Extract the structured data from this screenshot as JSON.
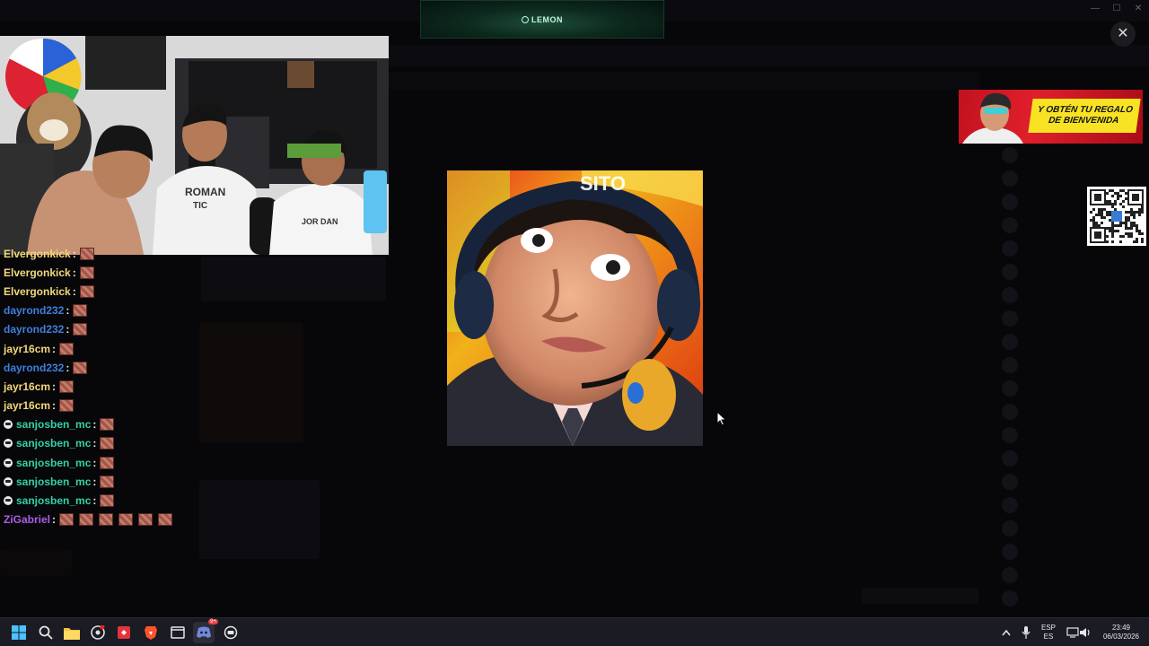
{
  "overlay": {
    "brand": "LEMON",
    "close_symbol": "✕"
  },
  "window_controls": [
    "—",
    "☐",
    "✕"
  ],
  "chat": {
    "messages": [
      {
        "user": "Elvergonkick",
        "color": "#f0d97a",
        "badge": false,
        "emotes": 1
      },
      {
        "user": "Elvergonkick",
        "color": "#f0d97a",
        "badge": false,
        "emotes": 1
      },
      {
        "user": "Elvergonkick",
        "color": "#f0d97a",
        "badge": false,
        "emotes": 1
      },
      {
        "user": "dayrond232",
        "color": "#3f7fdc",
        "badge": false,
        "emotes": 1
      },
      {
        "user": "dayrond232",
        "color": "#3f7fdc",
        "badge": false,
        "emotes": 1
      },
      {
        "user": "jayr16cm",
        "color": "#f0d97a",
        "badge": false,
        "emotes": 1
      },
      {
        "user": "dayrond232",
        "color": "#3f7fdc",
        "badge": false,
        "emotes": 1
      },
      {
        "user": "jayr16cm",
        "color": "#f0d97a",
        "badge": false,
        "emotes": 1
      },
      {
        "user": "jayr16cm",
        "color": "#f0d97a",
        "badge": false,
        "emotes": 1
      },
      {
        "user": "sanjosben_mc",
        "color": "#33d1a6",
        "badge": true,
        "emotes": 1
      },
      {
        "user": "sanjosben_mc",
        "color": "#33d1a6",
        "badge": true,
        "emotes": 1
      },
      {
        "user": "sanjosben_mc",
        "color": "#33d1a6",
        "badge": true,
        "emotes": 1
      },
      {
        "user": "sanjosben_mc",
        "color": "#33d1a6",
        "badge": true,
        "emotes": 1
      },
      {
        "user": "sanjosben_mc",
        "color": "#33d1a6",
        "badge": true,
        "emotes": 1
      },
      {
        "user": "ZiGabriel",
        "color": "#b05ce8",
        "badge": false,
        "emotes": 6
      }
    ],
    "separator": ":"
  },
  "ad": {
    "line1": "Y OBTÉN TU REGALO",
    "line2": "DE BIENVENIDA"
  },
  "taskbar": {
    "icons": [
      "windows-start-icon",
      "search-icon",
      "file-explorer-icon",
      "chrome-icon",
      "app-red-icon",
      "brave-icon",
      "window-app-icon",
      "discord-icon",
      "media-app-icon"
    ],
    "discord_badge": "9+",
    "lang_top": "ESP",
    "lang_bottom": "ES",
    "time": "23:49",
    "date": "06/03/2026"
  },
  "colors": {
    "accent_green": "#bff7dd",
    "ad_red": "#c1121f",
    "ad_yellow": "#f7e324"
  }
}
